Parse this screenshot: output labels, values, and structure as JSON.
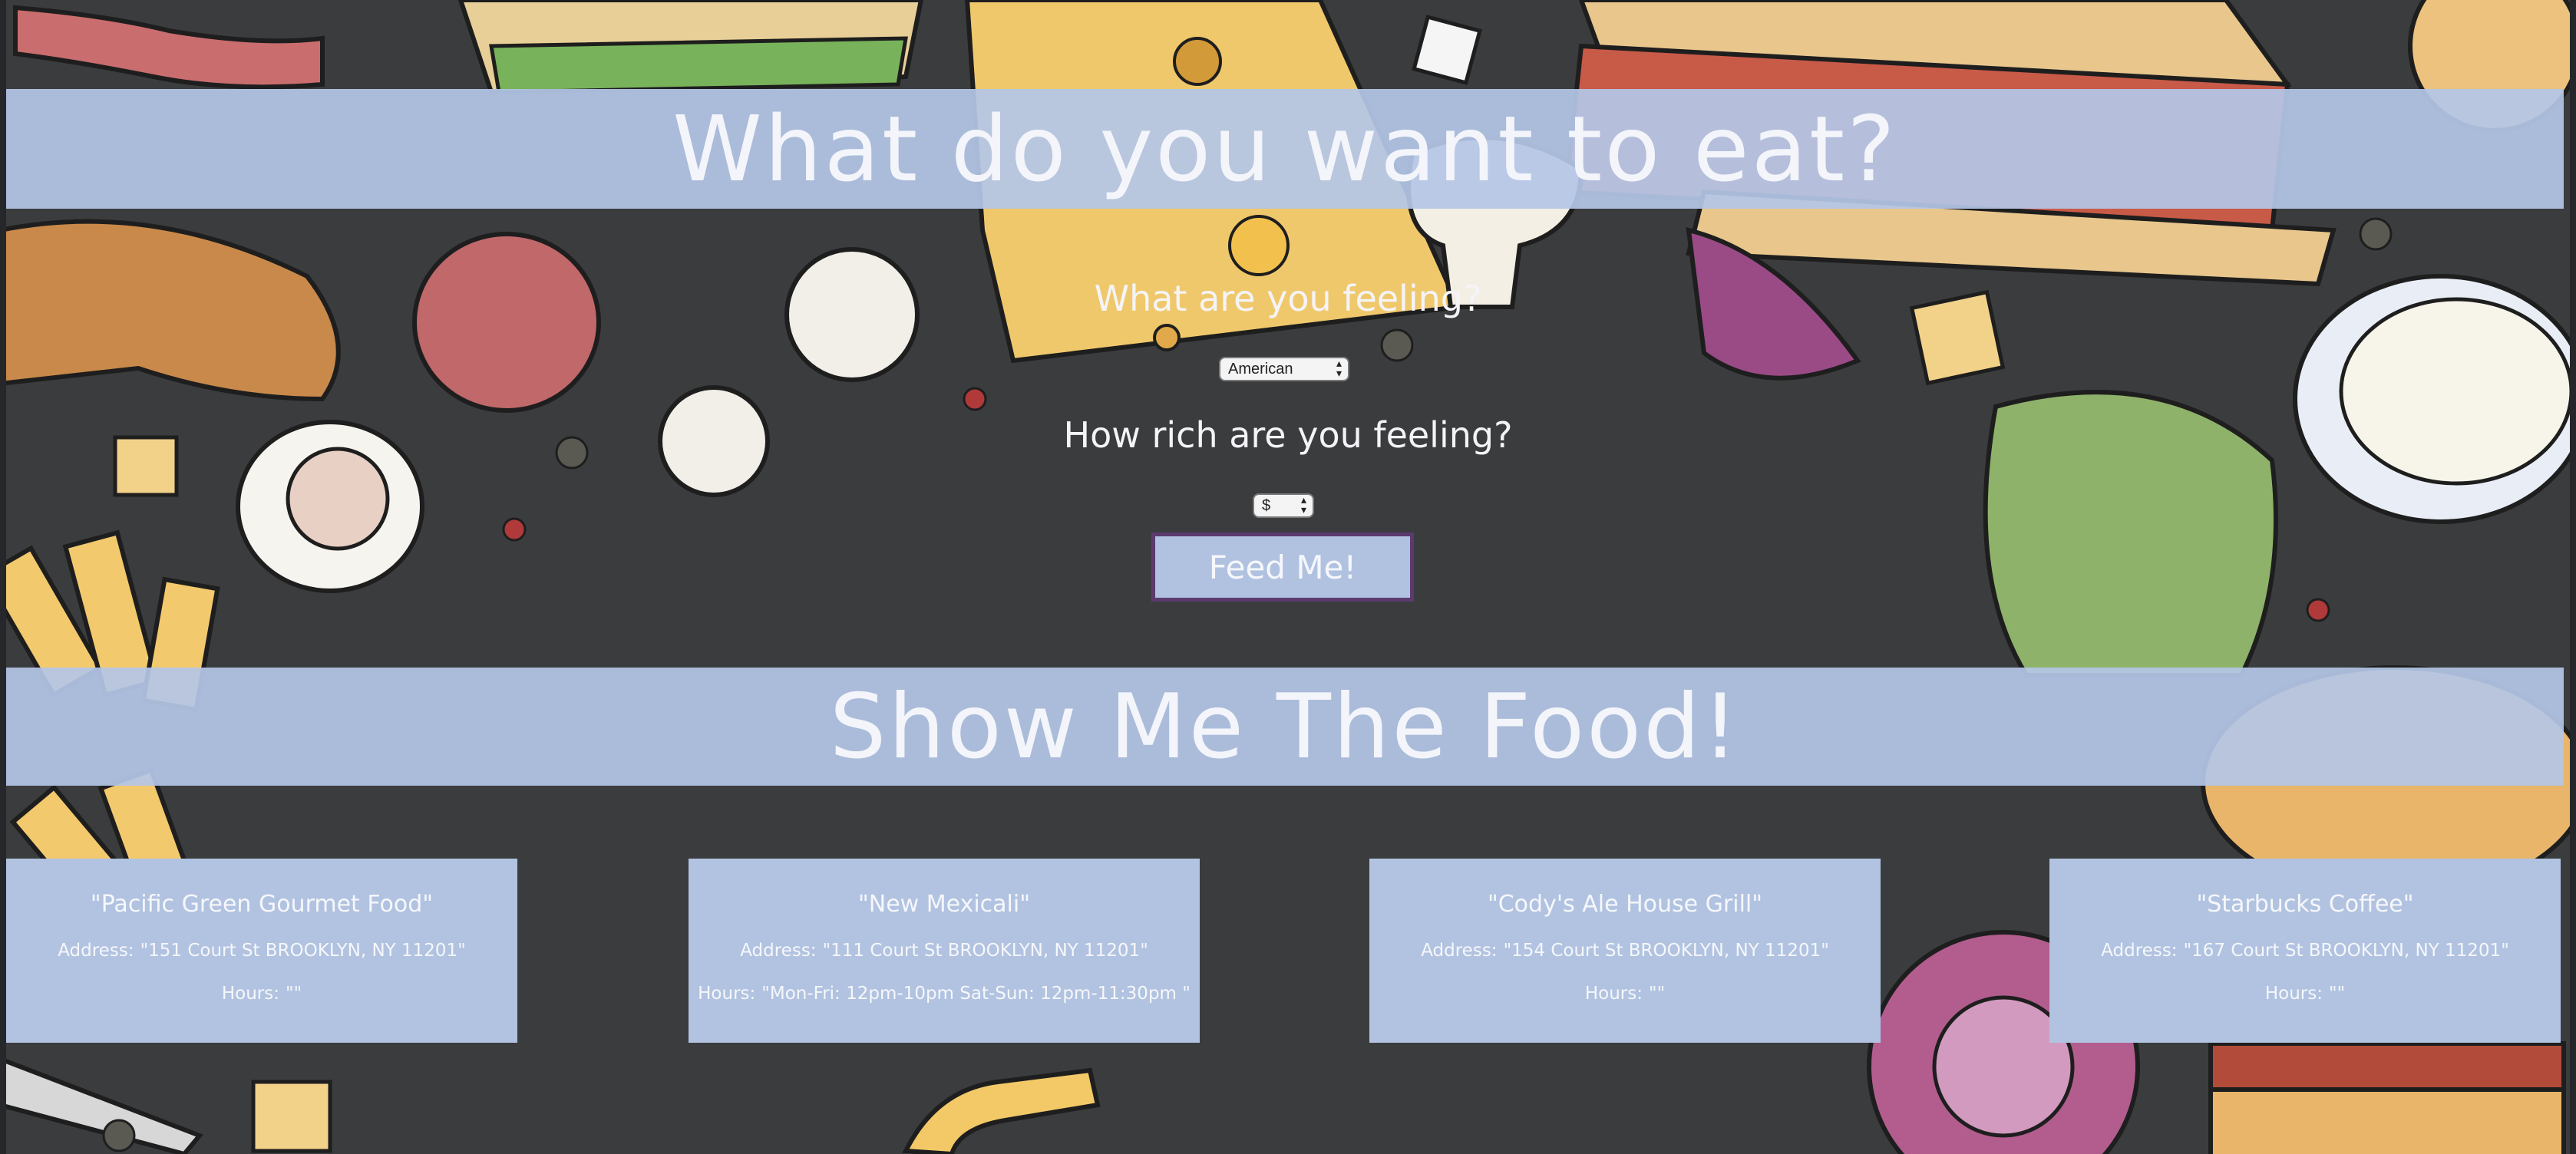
{
  "header": {
    "title": "What do you want to eat?"
  },
  "form": {
    "cuisine_question": "What are you feeling?",
    "cuisine_selected": "American",
    "price_question": "How rich are you feeling?",
    "price_selected": "$",
    "submit_label": "Feed Me!"
  },
  "results": {
    "title": "Show Me The Food!",
    "address_label": "Address:",
    "hours_label": "Hours:",
    "cards": [
      {
        "name": "\"Pacific Green Gourmet Food\"",
        "address": "\"151 Court St BROOKLYN, NY 11201\"",
        "hours": "\"\""
      },
      {
        "name": "\"New Mexicali\"",
        "address": "\"111 Court St BROOKLYN, NY 11201\"",
        "hours": "\"Mon-Fri: 12pm-10pm Sat-Sun: 12pm-11:30pm \""
      },
      {
        "name": "\"Cody's Ale House Grill\"",
        "address": "\"154 Court St BROOKLYN, NY 11201\"",
        "hours": "\"\""
      },
      {
        "name": "\"Starbucks Coffee\"",
        "address": "\"167 Court St BROOKLYN, NY 11201\"",
        "hours": "\"\""
      }
    ]
  },
  "colors": {
    "banner": "#b4c6e6",
    "card": "#b1c3e0",
    "button_border": "#5b3b6e",
    "background": "#3a3b3d"
  }
}
